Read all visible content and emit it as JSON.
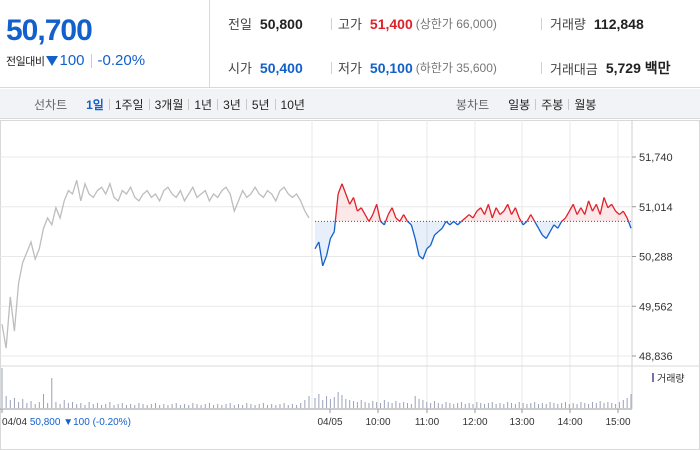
{
  "quote": {
    "price": "50,700",
    "change_label": "전일대비",
    "change_amount": "100",
    "change_percent": "-0.20%",
    "prev_close_label": "전일",
    "prev_close": "50,800",
    "high_label": "고가",
    "high": "51,400",
    "upper_limit": "(상한가 66,000)",
    "volume_label": "거래량",
    "volume": "112,848",
    "open_label": "시가",
    "open": "50,400",
    "low_label": "저가",
    "low": "50,100",
    "lower_limit": "(하한가 35,600)",
    "trade_value_label": "거래대금",
    "trade_value": "5,729 백만"
  },
  "toolbar": {
    "line_chart_label": "선차트",
    "periods": [
      "1일",
      "1주일",
      "3개월",
      "1년",
      "3년",
      "5년",
      "10년"
    ],
    "active_period": "1일",
    "candle_chart_label": "봉차트",
    "candle_periods": [
      "일봉",
      "주봉",
      "월봉"
    ]
  },
  "colors": {
    "up": "#e0202a",
    "down": "#1260cc",
    "prev_day_line": "#bdbdbd",
    "volume_bar": "#9aa2b8",
    "grid": "#e8e8e8"
  },
  "chart_data": {
    "type": "line",
    "y_ticks": [
      "51,740",
      "51,014",
      "50,288",
      "49,562",
      "48,836"
    ],
    "y_tick_values": [
      51740,
      51014,
      50288,
      49562,
      48836
    ],
    "ylim": [
      48836,
      51740
    ],
    "reference_price": 50800,
    "x_labels": [
      "04/04",
      "04/05",
      "10:00",
      "11:00",
      "12:00",
      "13:00",
      "14:00",
      "15:00"
    ],
    "legend": "거래량",
    "status_bar": {
      "date": "04/04",
      "price": "50,800",
      "change": "100",
      "pct": "(-0.20%)"
    },
    "series": [
      {
        "name": "04/04",
        "values": [
          49300,
          48950,
          49700,
          49200,
          49900,
          50200,
          50350,
          50500,
          50250,
          50400,
          50700,
          50850,
          50750,
          51000,
          50850,
          51100,
          51250,
          51200,
          51400,
          51100,
          51350,
          51200,
          51150,
          51250,
          51300,
          51200,
          51350,
          51150,
          51100,
          51250,
          51200,
          51300,
          51150,
          51100,
          51200,
          51250,
          51150,
          51200,
          51100,
          51250,
          51300,
          51200,
          51150,
          51250,
          51100,
          51200,
          51300,
          51150,
          51200,
          51250,
          51100,
          51200,
          51150,
          51250,
          51300,
          51200,
          50950,
          51100,
          51250,
          51150,
          51200,
          51300,
          51200,
          51150,
          51250,
          51200,
          51100,
          51250,
          51300,
          51200,
          51150,
          51200,
          51100,
          50950,
          50850
        ]
      },
      {
        "name": "04/05",
        "values": [
          50400,
          50500,
          50150,
          50300,
          50550,
          50650,
          51200,
          51350,
          51200,
          51050,
          51150,
          50950,
          51000,
          50900,
          50800,
          50900,
          51050,
          50800,
          50750,
          50900,
          51000,
          50850,
          50800,
          50900,
          50800,
          50750,
          50550,
          50300,
          50250,
          50400,
          50450,
          50600,
          50650,
          50700,
          50800,
          50750,
          50800,
          50750,
          50800,
          50850,
          50900,
          50850,
          50950,
          51000,
          50900,
          51050,
          50850,
          51000,
          50900,
          50950,
          51050,
          50900,
          51000,
          50850,
          50750,
          50800,
          50900,
          50800,
          50700,
          50600,
          50550,
          50650,
          50750,
          50700,
          50800,
          50850,
          50950,
          51050,
          50900,
          51000,
          50900,
          51100,
          50950,
          51050,
          50900,
          51150,
          51000,
          51050,
          50950,
          50900,
          50950,
          50850,
          50700
        ]
      }
    ],
    "volume": {
      "04/04": [
        40,
        12,
        8,
        10,
        6,
        9,
        5,
        7,
        4,
        6,
        14,
        5,
        30,
        6,
        4,
        8,
        5,
        6,
        4,
        5,
        3,
        6,
        4,
        5,
        3,
        4,
        6,
        3,
        4,
        5,
        3,
        4,
        3,
        5,
        4,
        3,
        4,
        5,
        3,
        4,
        3,
        4,
        5,
        3,
        4,
        3,
        5,
        4,
        3,
        4,
        5,
        3,
        4,
        3,
        4,
        5,
        3,
        4,
        3,
        5,
        4,
        3,
        4,
        5,
        3,
        4,
        3,
        4,
        5,
        3,
        4,
        3,
        5,
        8,
        12
      ],
      "04/05": [
        10,
        14,
        8,
        12,
        9,
        11,
        16,
        13,
        9,
        8,
        7,
        6,
        8,
        6,
        5,
        7,
        6,
        5,
        8,
        6,
        5,
        7,
        5,
        6,
        5,
        4,
        12,
        9,
        8,
        6,
        5,
        7,
        5,
        4,
        6,
        5,
        4,
        5,
        6,
        4,
        5,
        4,
        6,
        5,
        4,
        5,
        6,
        4,
        5,
        4,
        6,
        5,
        4,
        6,
        5,
        4,
        5,
        6,
        4,
        5,
        4,
        6,
        5,
        4,
        5,
        6,
        4,
        5,
        4,
        6,
        5,
        4,
        6,
        5,
        7,
        5,
        6,
        5,
        4,
        6,
        8,
        10,
        14
      ]
    }
  }
}
